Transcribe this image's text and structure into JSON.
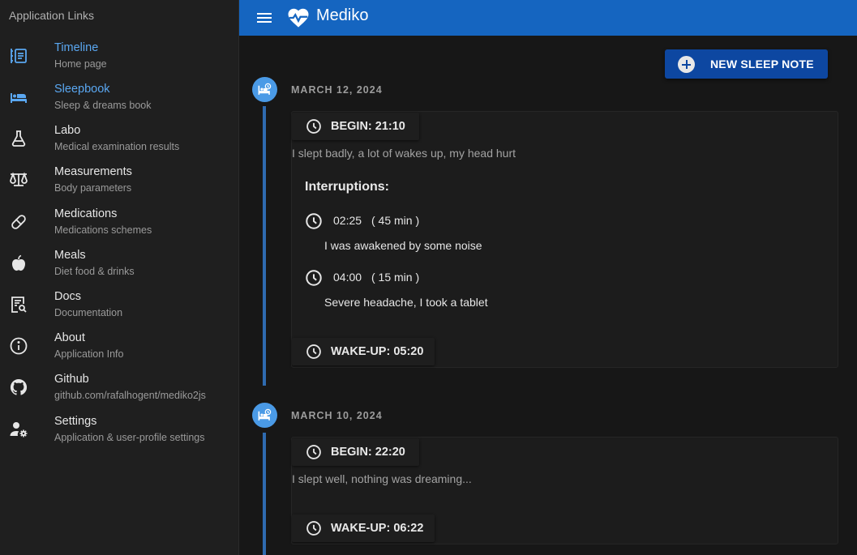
{
  "sidebar": {
    "title": "Application Links",
    "items": [
      {
        "label": "Timeline",
        "sub": "Home page",
        "icon": "timeline-icon"
      },
      {
        "label": "Sleepbook",
        "sub": "Sleep & dreams book",
        "icon": "bed-icon"
      },
      {
        "label": "Labo",
        "sub": "Medical examination results",
        "icon": "flask-icon"
      },
      {
        "label": "Measurements",
        "sub": "Body parameters",
        "icon": "scale-icon"
      },
      {
        "label": "Medications",
        "sub": "Medications schemes",
        "icon": "pill-icon"
      },
      {
        "label": "Meals",
        "sub": "Diet food & drinks",
        "icon": "apple-icon"
      },
      {
        "label": "Docs",
        "sub": "Documentation",
        "icon": "document-search-icon"
      },
      {
        "label": "About",
        "sub": "Application Info",
        "icon": "info-icon"
      },
      {
        "label": "Github",
        "sub": "github.com/rafalhogent/mediko2js",
        "icon": "github-icon"
      },
      {
        "label": "Settings",
        "sub": "Application & user-profile settings",
        "icon": "user-settings-icon"
      }
    ],
    "active_index": 1
  },
  "header": {
    "title": "Mediko",
    "logo_icon": "heart-pulse-icon",
    "menu_icon": "hamburger-menu-icon"
  },
  "toolbar": {
    "new_label": "NEW SLEEP NOTE"
  },
  "entries": [
    {
      "date": "MARCH 12, 2024",
      "begin": "BEGIN: 21:10",
      "note": "I slept badly, a lot of wakes up, my head hurt",
      "interruptions_title": "Interruptions:",
      "interruptions": [
        {
          "time": "02:25",
          "duration": "( 45 min )",
          "desc": "I was awakened by some noise"
        },
        {
          "time": "04:00",
          "duration": "( 15 min )",
          "desc": "Severe headache, I took a tablet"
        }
      ],
      "wakeup": "WAKE-UP: 05:20"
    },
    {
      "date": "MARCH 10, 2024",
      "begin": "BEGIN: 22:20",
      "note": "I slept well, nothing was dreaming...",
      "wakeup": "WAKE-UP: 06:22"
    }
  ],
  "colors": {
    "accent": "#1565c0",
    "button": "#0d47a1",
    "active_nav": "#5aa7f1",
    "timeline": "#4a9ae6"
  }
}
